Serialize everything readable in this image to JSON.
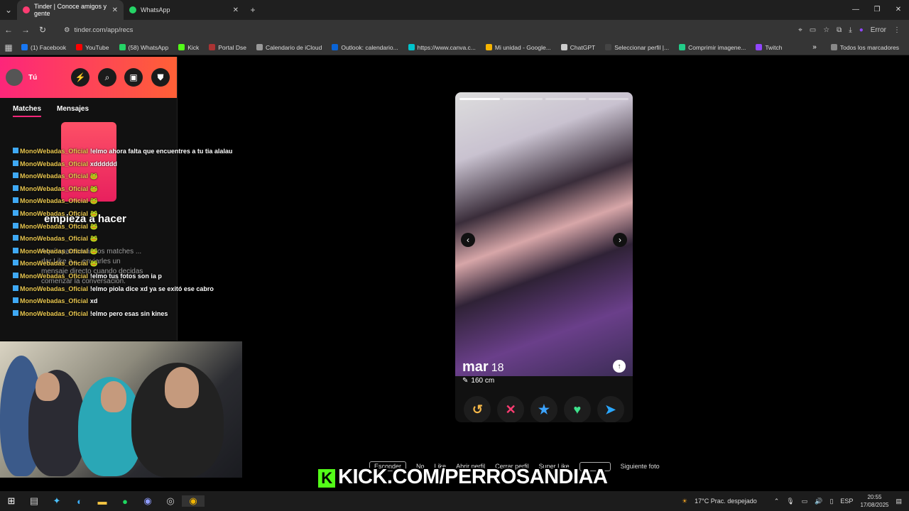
{
  "browser": {
    "tabs": [
      {
        "title": "Tinder | Conoce amigos y gente",
        "color": "#fe3c72"
      },
      {
        "title": "WhatsApp",
        "color": "#25d366"
      }
    ],
    "url": "tinder.com/app/recs",
    "error_label": "Error",
    "bookmarks": [
      {
        "label": "(1) Facebook",
        "color": "#1877f2"
      },
      {
        "label": "YouTube",
        "color": "#ff0000"
      },
      {
        "label": "(58) WhatsApp",
        "color": "#25d366"
      },
      {
        "label": "Kick",
        "color": "#53fc18"
      },
      {
        "label": "Portal Dse",
        "color": "#a33"
      },
      {
        "label": "Calendario de iCloud",
        "color": "#999"
      },
      {
        "label": "Outlook: calendario...",
        "color": "#0a64d6"
      },
      {
        "label": "https://www.canva.c...",
        "color": "#00c4cc"
      },
      {
        "label": "Mi unidad - Google...",
        "color": "#f6b400"
      },
      {
        "label": "ChatGPT",
        "color": "#ccc"
      },
      {
        "label": "Seleccionar perfil |...",
        "color": "#444"
      },
      {
        "label": "Comprimir imagene...",
        "color": "#2c8"
      },
      {
        "label": "Twitch",
        "color": "#9146ff"
      }
    ],
    "all_bookmarks": "Todos los marcadores"
  },
  "sidebar": {
    "user_label": "Tú",
    "tabs": [
      "Matches",
      "Mensajes"
    ],
    "empty_title": "empieza a hacer",
    "empty_text": "Aquí aparecerán los matches ... dar Like a ... enviarles un mensaje directo cuando decidas comenzar la conversación."
  },
  "chat": [
    {
      "user": "MonoWebadas_Oficial",
      "text": "!elmo ahora falta que encuentres a tu tia alalau"
    },
    {
      "user": "MonoWebadas_Oficial",
      "text": "xdddddd"
    },
    {
      "user": "MonoWebadas_Oficial",
      "text": "🐸"
    },
    {
      "user": "MonoWebadas_Oficial",
      "text": "🐸"
    },
    {
      "user": "MonoWebadas_Oficial",
      "text": "🐸"
    },
    {
      "user": "MonoWebadas_Oficial",
      "text": "🐸"
    },
    {
      "user": "MonoWebadas_Oficial",
      "text": "🐸"
    },
    {
      "user": "MonoWebadas_Oficial",
      "text": "🐸"
    },
    {
      "user": "MonoWebadas_Oficial",
      "text": "🐸"
    },
    {
      "user": "MonoWebadas_Oficial",
      "text": "🐸"
    },
    {
      "user": "MonoWebadas_Oficial",
      "text": "!elmo tus fotos son ia p"
    },
    {
      "user": "MonoWebadas_Oficial",
      "text": "!elmo piola dice xd ya se exitó ese cabro"
    },
    {
      "user": "MonoWebadas_Oficial",
      "text": "xd"
    },
    {
      "user": "MonoWebadas_Oficial",
      "text": "!elmo pero esas sin kines"
    }
  ],
  "profile": {
    "name": "mar",
    "age": "18",
    "height": "160 cm"
  },
  "shortcuts": {
    "hide": "Esconder",
    "no": "No",
    "like": "Like",
    "open": "Abrir perfil",
    "close": "Cerrar perfil",
    "super": "Super Like",
    "next": "Siguiente foto"
  },
  "overlay": {
    "kick_text": "KICK.COM/PERROSANDIAA"
  },
  "taskbar": {
    "weather": "17°C  Prac. despejado",
    "lang": "ESP",
    "time": "20:55",
    "date": "17/08/2025"
  }
}
